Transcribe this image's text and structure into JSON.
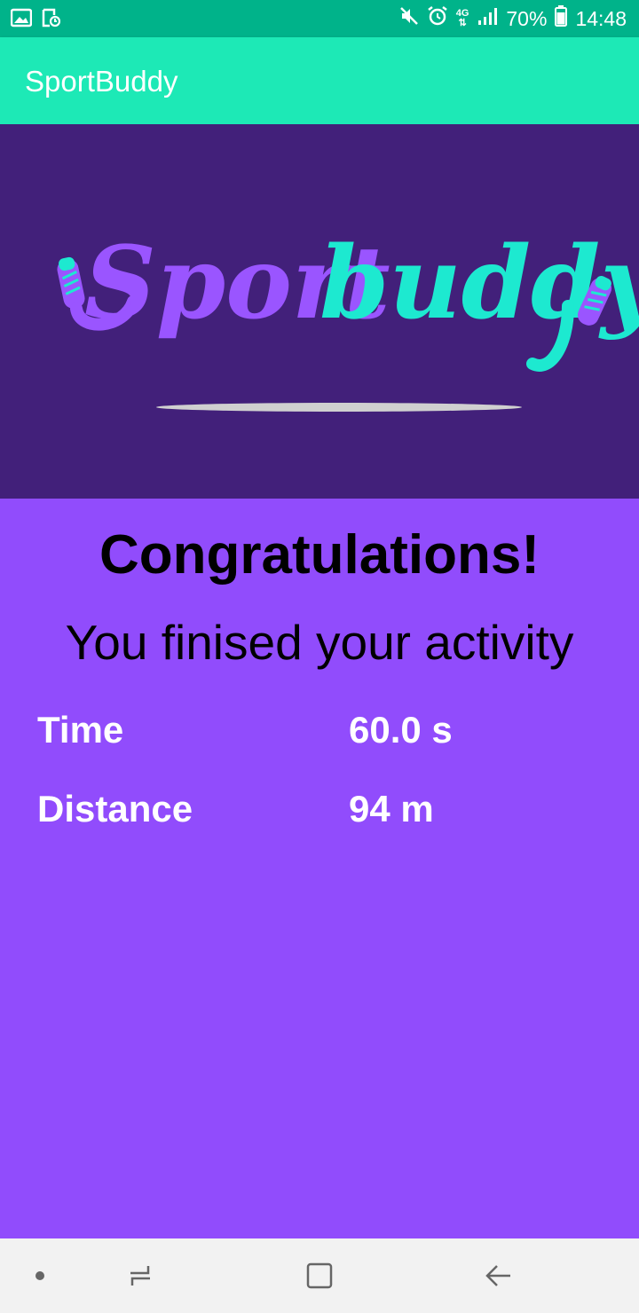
{
  "status_bar": {
    "battery": "70%",
    "time": "14:48",
    "network": "4G",
    "icons": [
      "image-icon",
      "screenshot-icon",
      "mute-icon",
      "alarm-icon",
      "network-icon",
      "signal-icon",
      "battery-icon"
    ]
  },
  "app_bar": {
    "title": "SportBuddy"
  },
  "banner": {
    "logo_part1": "Sport",
    "logo_part2": "buddy"
  },
  "content": {
    "heading": "Congratulations!",
    "subheading": "You finised your activity",
    "stats": [
      {
        "label": "Time",
        "value": "60.0 s"
      },
      {
        "label": "Distance",
        "value": "94 m"
      }
    ]
  },
  "colors": {
    "status_bar": "#00b38a",
    "app_bar": "#1de9b6",
    "banner": "#42207a",
    "content": "#914cfc",
    "logo_purple": "#9a55ff",
    "logo_teal": "#1de9d0"
  },
  "nav_bar": {
    "icons": [
      "dot-icon",
      "recents-icon",
      "home-icon",
      "back-icon"
    ]
  }
}
